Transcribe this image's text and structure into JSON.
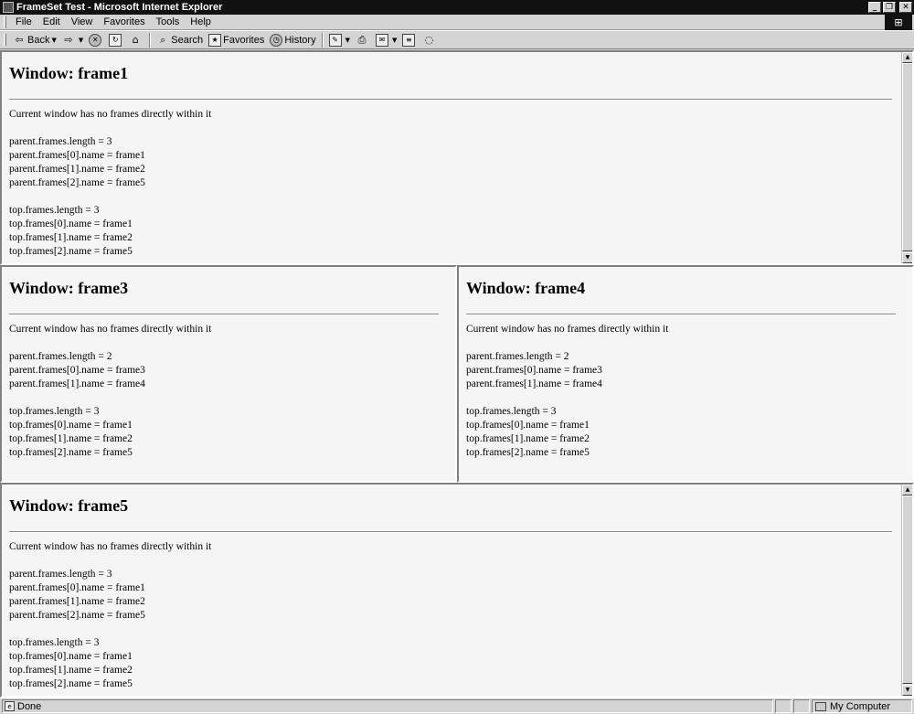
{
  "window": {
    "title": "FrameSet Test - Microsoft Internet Explorer",
    "controls": {
      "minimize": "_",
      "maximize": "❐",
      "close": "✕"
    }
  },
  "menu": [
    "File",
    "Edit",
    "View",
    "Favorites",
    "Tools",
    "Help"
  ],
  "toolbar": {
    "back_label": "Back",
    "search_label": "Search",
    "favorites_label": "Favorites",
    "history_label": "History"
  },
  "frames": {
    "frame1": {
      "title": "Window: frame1",
      "message": "Current window has no frames directly within it",
      "parent_lines": [
        "parent.frames.length = 3",
        "parent.frames[0].name = frame1",
        "parent.frames[1].name = frame2",
        "parent.frames[2].name = frame5"
      ],
      "top_lines": [
        "top.frames.length = 3",
        "top.frames[0].name = frame1",
        "top.frames[1].name = frame2",
        "top.frames[2].name = frame5"
      ]
    },
    "frame3": {
      "title": "Window: frame3",
      "message": "Current window has no frames directly within it",
      "parent_lines": [
        "parent.frames.length = 2",
        "parent.frames[0].name = frame3",
        "parent.frames[1].name = frame4"
      ],
      "top_lines": [
        "top.frames.length = 3",
        "top.frames[0].name = frame1",
        "top.frames[1].name = frame2",
        "top.frames[2].name = frame5"
      ]
    },
    "frame4": {
      "title": "Window: frame4",
      "message": "Current window has no frames directly within it",
      "parent_lines": [
        "parent.frames.length = 2",
        "parent.frames[0].name = frame3",
        "parent.frames[1].name = frame4"
      ],
      "top_lines": [
        "top.frames.length = 3",
        "top.frames[0].name = frame1",
        "top.frames[1].name = frame2",
        "top.frames[2].name = frame5"
      ]
    },
    "frame5": {
      "title": "Window: frame5",
      "message": "Current window has no frames directly within it",
      "parent_lines": [
        "parent.frames.length = 3",
        "parent.frames[0].name = frame1",
        "parent.frames[1].name = frame2",
        "parent.frames[2].name = frame5"
      ],
      "top_lines": [
        "top.frames.length = 3",
        "top.frames[0].name = frame1",
        "top.frames[1].name = frame2",
        "top.frames[2].name = frame5"
      ]
    }
  },
  "status": {
    "text": "Done",
    "zone": "My Computer"
  }
}
